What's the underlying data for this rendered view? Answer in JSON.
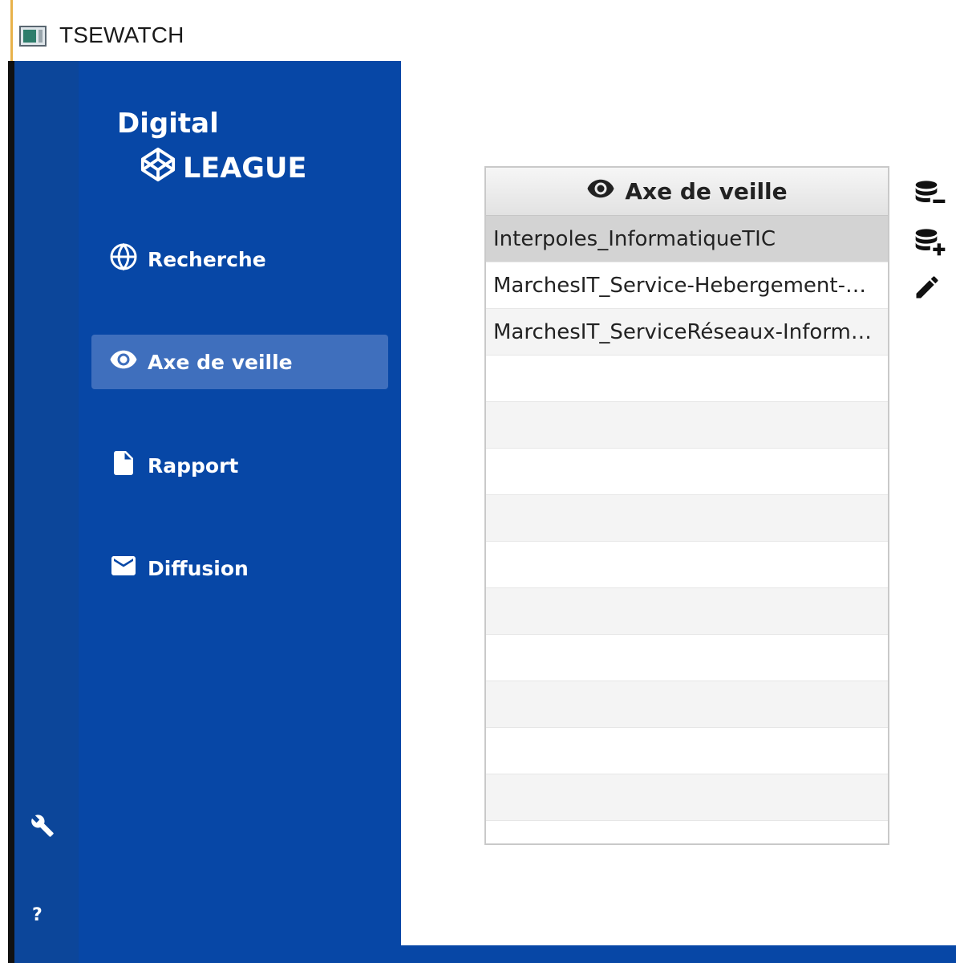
{
  "window": {
    "title": "TSEWATCH"
  },
  "logo": {
    "line1": "Digital",
    "line2": "LEAGUE"
  },
  "nav": {
    "items": [
      {
        "label": "Recherche",
        "icon": "globe-icon"
      },
      {
        "label": "Axe de veille",
        "icon": "eye-icon",
        "active": true
      },
      {
        "label": "Rapport",
        "icon": "document-icon"
      },
      {
        "label": "Diffusion",
        "icon": "mail-icon"
      }
    ]
  },
  "rail": {
    "settings_icon": "wrench-icon",
    "help_label": "?"
  },
  "table": {
    "header": "Axe de veille",
    "rows": [
      "Interpoles_InformatiqueTIC",
      "MarchesIT_Service-Hebergement-…",
      "MarchesIT_ServiceRéseaux-Inform…"
    ],
    "selected_index": 0
  },
  "actions": {
    "icons": [
      "database-remove-icon",
      "database-add-icon",
      "pencil-icon"
    ]
  },
  "colors": {
    "sidebar": "#0747a6",
    "rail": "#0c469a",
    "active_item": "#3f6fbd",
    "selected_row": "#d3d3d3"
  }
}
